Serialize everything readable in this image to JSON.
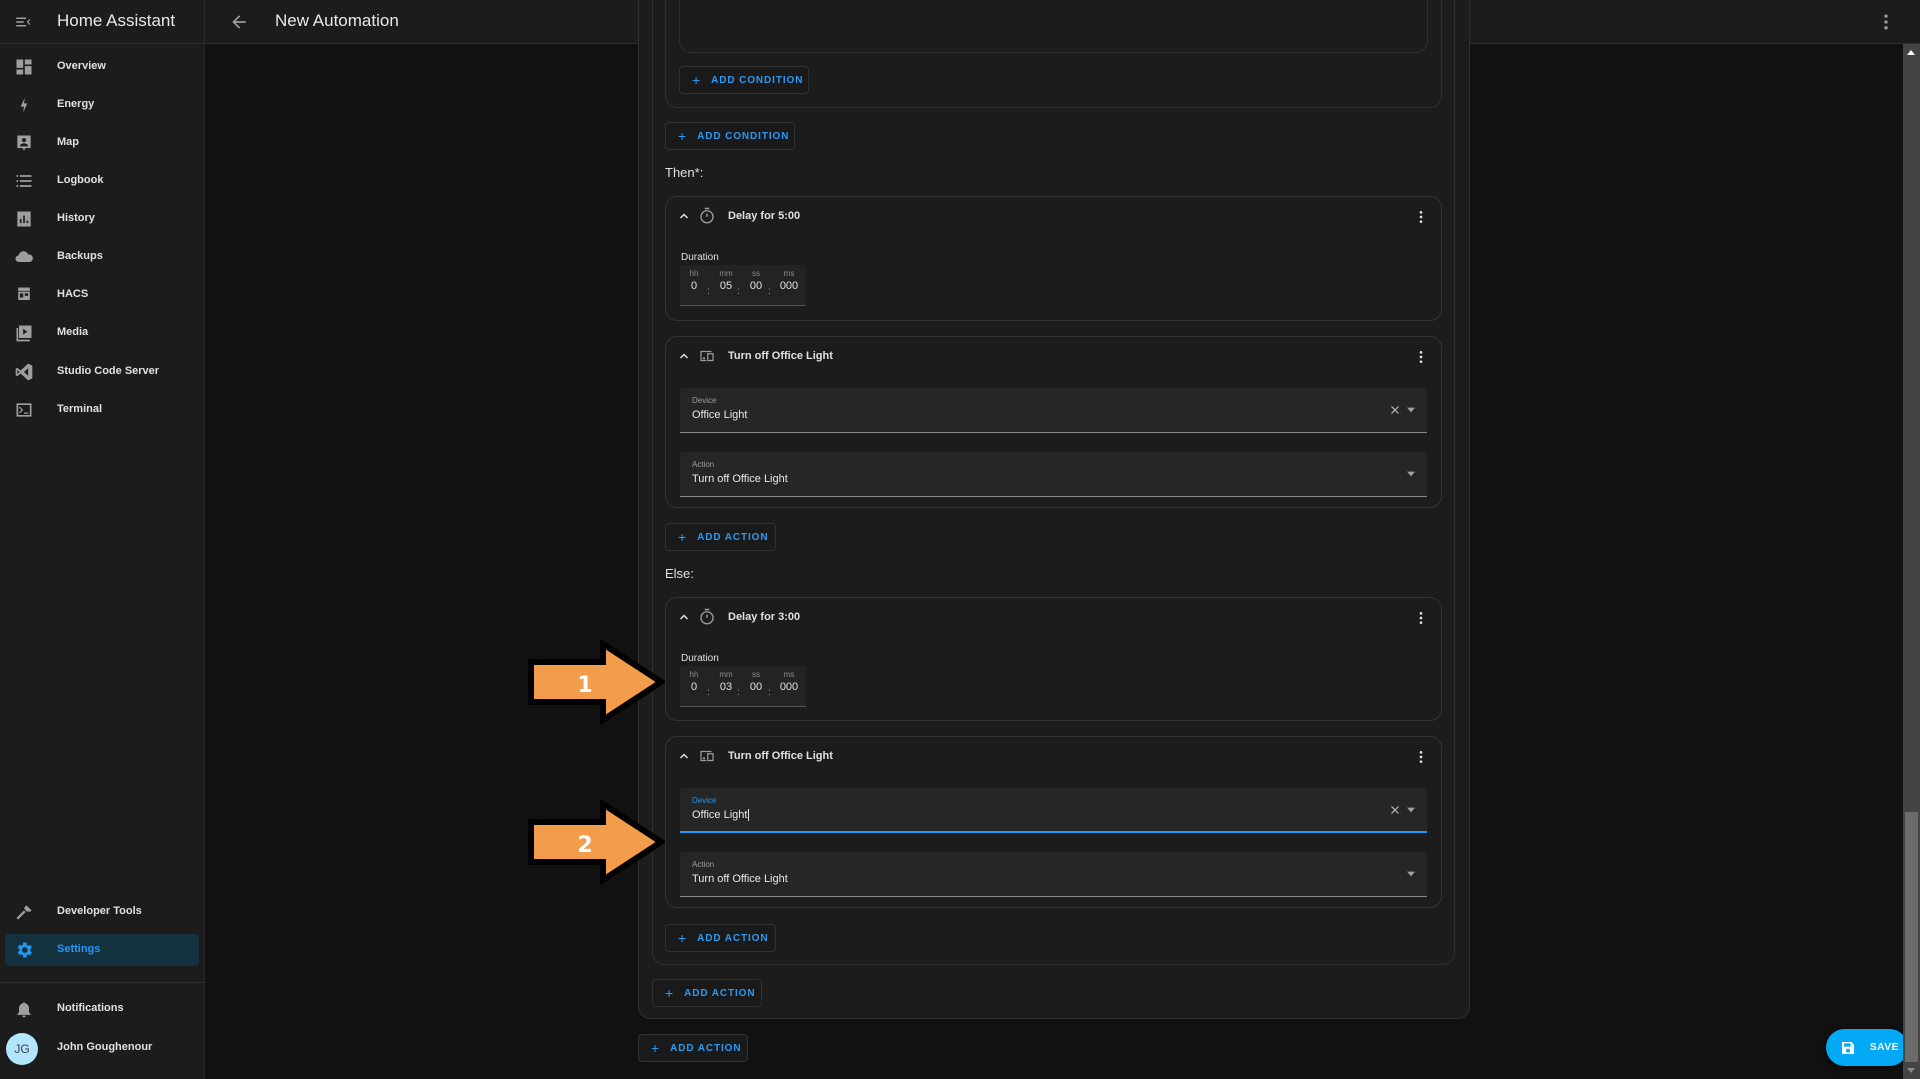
{
  "app": {
    "title": "Home Assistant",
    "page_title": "New Automation"
  },
  "sidebar": {
    "items": [
      {
        "label": "Overview",
        "icon": "dashboard-icon"
      },
      {
        "label": "Energy",
        "icon": "lightning-bolt-icon"
      },
      {
        "label": "Map",
        "icon": "map-icon"
      },
      {
        "label": "Logbook",
        "icon": "list-icon"
      },
      {
        "label": "History",
        "icon": "chart-box-icon"
      },
      {
        "label": "Backups",
        "icon": "cloud-icon"
      },
      {
        "label": "HACS",
        "icon": "hacs-icon"
      },
      {
        "label": "Media",
        "icon": "play-box-icon"
      },
      {
        "label": "Studio Code Server",
        "icon": "vscode-icon"
      },
      {
        "label": "Terminal",
        "icon": "console-icon"
      }
    ],
    "bottom_items": [
      {
        "label": "Developer Tools",
        "icon": "hammer-icon"
      },
      {
        "label": "Settings",
        "icon": "gear-icon",
        "active": true
      }
    ],
    "notifications_label": "Notifications",
    "user": {
      "name": "John Goughenour",
      "initials": "JG"
    }
  },
  "editor": {
    "add_condition_label": "ADD CONDITION",
    "add_action_label": "ADD ACTION",
    "then_label": "Then*:",
    "else_label": "Else:",
    "then_actions": [
      {
        "type": "delay",
        "title": "Delay for 5:00",
        "duration_label": "Duration",
        "units": [
          "hh",
          "mm",
          "ss",
          "ms"
        ],
        "values": [
          "0",
          "05",
          "00",
          "000"
        ]
      },
      {
        "type": "device",
        "title": "Turn off Office Light",
        "device_label": "Device",
        "device_value": "Office Light",
        "action_label": "Action",
        "action_value": "Turn off Office Light"
      }
    ],
    "else_actions": [
      {
        "type": "delay",
        "title": "Delay for 3:00",
        "duration_label": "Duration",
        "units": [
          "hh",
          "mm",
          "ss",
          "ms"
        ],
        "values": [
          "0",
          "03",
          "00",
          "000"
        ]
      },
      {
        "type": "device",
        "title": "Turn off Office Light",
        "device_label": "Device",
        "device_value": "Office Light",
        "action_label": "Action",
        "action_value": "Turn off Office Light",
        "focused": true
      }
    ]
  },
  "annotations": [
    {
      "label": "1",
      "color": "#f39c4b"
    },
    {
      "label": "2",
      "color": "#f39c4b"
    }
  ],
  "save_label": "SAVE",
  "colors": {
    "accent": "#03a9f4",
    "link": "#2b9af3",
    "annotation": "#f39c4b"
  }
}
